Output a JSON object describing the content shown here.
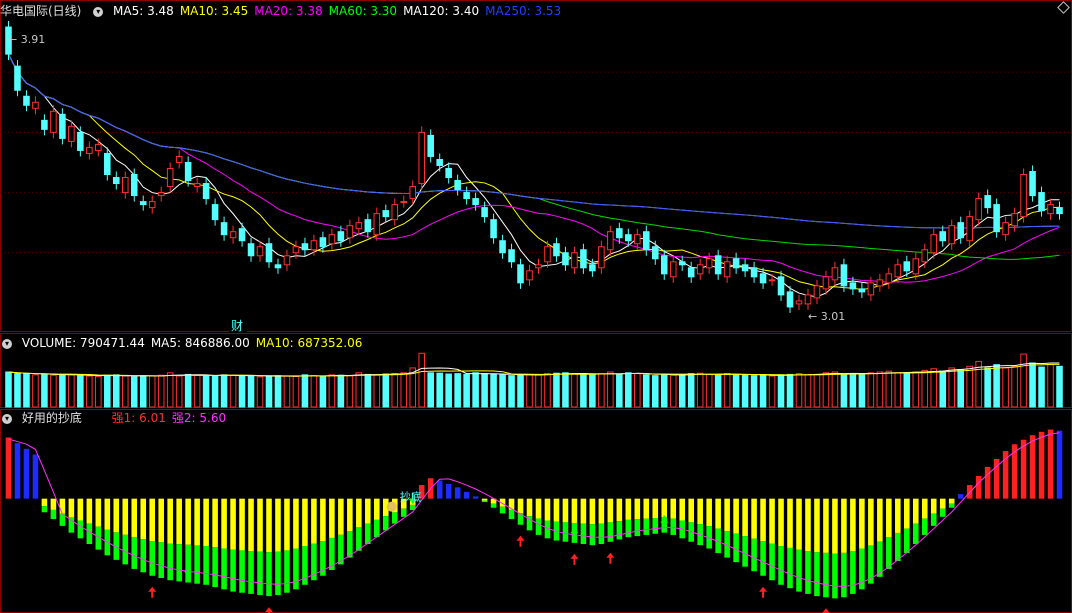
{
  "panels": {
    "price": {
      "title": "华电国际(日线)",
      "indicators": [
        {
          "label": "MA5: 3.48",
          "color": "#ffffff"
        },
        {
          "label": "MA10: 3.45",
          "color": "#ffff00"
        },
        {
          "label": "MA20: 3.38",
          "color": "#ff00ff"
        },
        {
          "label": "MA60: 3.30",
          "color": "#00ff00"
        },
        {
          "label": "MA120: 3.40",
          "color": "#ffffff"
        },
        {
          "label": "MA250: 3.53",
          "color": "#2040ff"
        }
      ],
      "annotation_high": "3.91",
      "annotation_low": "3.01",
      "marker_text": "财"
    },
    "volume": {
      "indicators": [
        {
          "label": "VOLUME: 790471.44",
          "color": "#ffffff"
        },
        {
          "label": "MA5: 846886.00",
          "color": "#ffffff"
        },
        {
          "label": "MA10: 687352.06",
          "color": "#ffff00"
        }
      ]
    },
    "oscillator": {
      "title": "好用的抄底",
      "indicators": [
        {
          "label": "强1: 6.01",
          "color": "#ff3030"
        },
        {
          "label": "强2: 5.60",
          "color": "#ff30ff"
        }
      ],
      "signal_label": "抄底"
    }
  },
  "chart_data": {
    "type": "candlestick",
    "series_note": "",
    "price_range": [
      2.95,
      3.98
    ],
    "close": [
      3.86,
      3.74,
      3.69,
      3.7,
      3.61,
      3.67,
      3.58,
      3.62,
      3.54,
      3.55,
      3.56,
      3.46,
      3.43,
      3.45,
      3.39,
      3.36,
      3.37,
      3.4,
      3.48,
      3.52,
      3.44,
      3.43,
      3.38,
      3.31,
      3.26,
      3.27,
      3.24,
      3.19,
      3.22,
      3.17,
      3.15,
      3.19,
      3.22,
      3.21,
      3.24,
      3.22,
      3.26,
      3.24,
      3.29,
      3.3,
      3.27,
      3.33,
      3.32,
      3.36,
      3.37,
      3.42,
      3.6,
      3.52,
      3.49,
      3.45,
      3.41,
      3.38,
      3.36,
      3.32,
      3.25,
      3.2,
      3.17,
      3.1,
      3.14,
      3.16,
      3.22,
      3.19,
      3.16,
      3.2,
      3.15,
      3.14,
      3.22,
      3.27,
      3.25,
      3.24,
      3.26,
      3.21,
      3.18,
      3.13,
      3.17,
      3.16,
      3.12,
      3.16,
      3.18,
      3.13,
      3.17,
      3.15,
      3.14,
      3.12,
      3.1,
      3.11,
      3.06,
      3.02,
      3.04,
      3.06,
      3.09,
      3.12,
      3.15,
      3.09,
      3.08,
      3.07,
      3.1,
      3.11,
      3.13,
      3.16,
      3.14,
      3.18,
      3.21,
      3.26,
      3.24,
      3.29,
      3.25,
      3.32,
      3.38,
      3.35,
      3.27,
      3.3,
      3.33,
      3.46,
      3.39,
      3.34,
      3.36,
      3.33
    ],
    "open": [
      3.95,
      3.82,
      3.72,
      3.68,
      3.64,
      3.6,
      3.66,
      3.57,
      3.6,
      3.53,
      3.54,
      3.53,
      3.45,
      3.4,
      3.46,
      3.37,
      3.35,
      3.39,
      3.42,
      3.5,
      3.5,
      3.42,
      3.43,
      3.36,
      3.3,
      3.25,
      3.28,
      3.23,
      3.19,
      3.23,
      3.16,
      3.16,
      3.2,
      3.23,
      3.21,
      3.25,
      3.23,
      3.27,
      3.25,
      3.28,
      3.31,
      3.26,
      3.34,
      3.31,
      3.37,
      3.38,
      3.43,
      3.59,
      3.51,
      3.48,
      3.44,
      3.4,
      3.38,
      3.35,
      3.31,
      3.24,
      3.21,
      3.16,
      3.11,
      3.15,
      3.17,
      3.23,
      3.2,
      3.15,
      3.21,
      3.16,
      3.15,
      3.21,
      3.28,
      3.26,
      3.23,
      3.27,
      3.22,
      3.19,
      3.12,
      3.17,
      3.15,
      3.13,
      3.15,
      3.19,
      3.12,
      3.18,
      3.16,
      3.15,
      3.13,
      3.11,
      3.12,
      3.07,
      3.03,
      3.03,
      3.05,
      3.08,
      3.11,
      3.16,
      3.1,
      3.08,
      3.06,
      3.09,
      3.1,
      3.12,
      3.17,
      3.13,
      3.17,
      3.2,
      3.27,
      3.23,
      3.3,
      3.24,
      3.31,
      3.39,
      3.36,
      3.26,
      3.29,
      3.32,
      3.47,
      3.4,
      3.33,
      3.35
    ],
    "volume_values": [
      430,
      410,
      405,
      395,
      400,
      390,
      400,
      395,
      385,
      380,
      375,
      390,
      395,
      380,
      370,
      385,
      380,
      390,
      420,
      380,
      400,
      390,
      380,
      385,
      395,
      390,
      380,
      385,
      370,
      375,
      385,
      380,
      375,
      395,
      385,
      380,
      395,
      390,
      385,
      420,
      400,
      395,
      405,
      410,
      420,
      480,
      660,
      420,
      415,
      405,
      410,
      400,
      420,
      410,
      400,
      395,
      385,
      390,
      400,
      395,
      410,
      415,
      420,
      410,
      400,
      395,
      410,
      430,
      400,
      420,
      410,
      395,
      385,
      400,
      390,
      395,
      410,
      415,
      400,
      395,
      410,
      400,
      395,
      385,
      390,
      380,
      395,
      400,
      410,
      395,
      400,
      420,
      430,
      405,
      410,
      395,
      420,
      430,
      440,
      420,
      410,
      430,
      450,
      470,
      440,
      480,
      460,
      500,
      560,
      480,
      520,
      480,
      500,
      650,
      540,
      490,
      520,
      500
    ],
    "volume_range": [
      0,
      700
    ],
    "oscillator_values": [
      5.4,
      4.9,
      4.4,
      3.9,
      -1.2,
      -1.8,
      -2.4,
      -3.0,
      -3.5,
      -4.0,
      -4.5,
      -5.0,
      -5.4,
      -5.8,
      -6.2,
      -6.5,
      -6.8,
      -7.0,
      -7.2,
      -7.3,
      -7.4,
      -7.5,
      -7.6,
      -7.8,
      -8.0,
      -8.2,
      -8.3,
      -8.4,
      -8.5,
      -8.6,
      -8.5,
      -8.3,
      -8.0,
      -7.6,
      -7.2,
      -6.8,
      -6.3,
      -5.8,
      -5.2,
      -4.6,
      -4.0,
      -3.4,
      -2.8,
      -2.2,
      -1.6,
      -1.0,
      1.2,
      1.8,
      1.6,
      1.3,
      1.0,
      0.6,
      0.2,
      -0.3,
      -0.8,
      -1.3,
      -1.8,
      -2.3,
      -2.8,
      -3.2,
      -3.5,
      -3.7,
      -3.8,
      -3.9,
      -4.0,
      -4.1,
      -4.0,
      -3.8,
      -3.6,
      -3.4,
      -3.3,
      -3.2,
      -3.1,
      -3.0,
      -3.2,
      -3.5,
      -3.8,
      -4.1,
      -4.4,
      -4.8,
      -5.2,
      -5.6,
      -6.0,
      -6.4,
      -6.8,
      -7.2,
      -7.6,
      -7.9,
      -8.2,
      -8.4,
      -8.6,
      -8.7,
      -8.8,
      -8.7,
      -8.4,
      -8.0,
      -7.5,
      -6.9,
      -6.2,
      -5.5,
      -4.8,
      -4.0,
      -3.2,
      -2.4,
      -1.6,
      -0.8,
      0.4,
      1.2,
      2.0,
      2.8,
      3.5,
      4.2,
      4.8,
      5.2,
      5.6,
      5.9,
      6.1,
      6.0
    ],
    "oscillator_range": [
      -10,
      6.5
    ],
    "buy_signals": [
      16,
      29,
      57,
      63,
      67,
      84,
      91
    ],
    "sell_signals": [
      20,
      45,
      63,
      73
    ]
  }
}
